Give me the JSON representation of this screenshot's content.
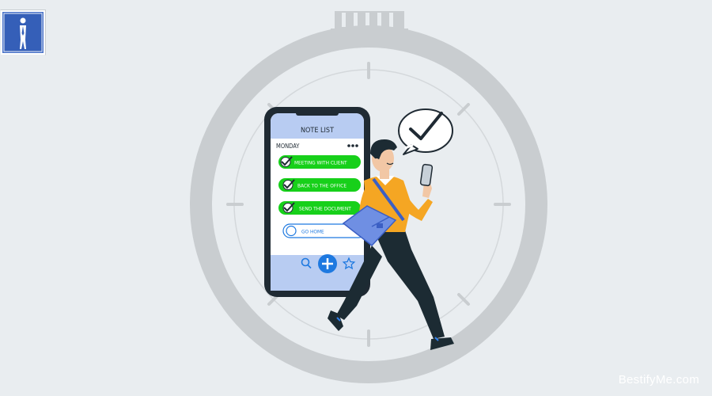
{
  "phone": {
    "title": "NOTE LIST",
    "day": "MONDAY",
    "tasks": [
      {
        "label": "MEETING WITH CLIENT",
        "done": true
      },
      {
        "label": "BACK TO THE OFFICE",
        "done": true
      },
      {
        "label": "SEND THE DOCUMENT",
        "done": true
      },
      {
        "label": "GO HOME",
        "done": false
      }
    ]
  },
  "watermark": "BestifyMe.com",
  "colors": {
    "background": "#e9edf0",
    "stopwatch": "#c9cdd0",
    "phone_body": "#1f2a33",
    "phone_screen": "#ffffff",
    "phone_header": "#b8ccf2",
    "task_done": "#17d01a",
    "accent_blue": "#1e79e0",
    "shirt": "#f5a623",
    "pants": "#1c2b33"
  },
  "icons": [
    "stopwatch-icon",
    "check-bubble-icon",
    "search-icon",
    "add-icon",
    "star-icon",
    "more-icon",
    "logo-icon"
  ]
}
